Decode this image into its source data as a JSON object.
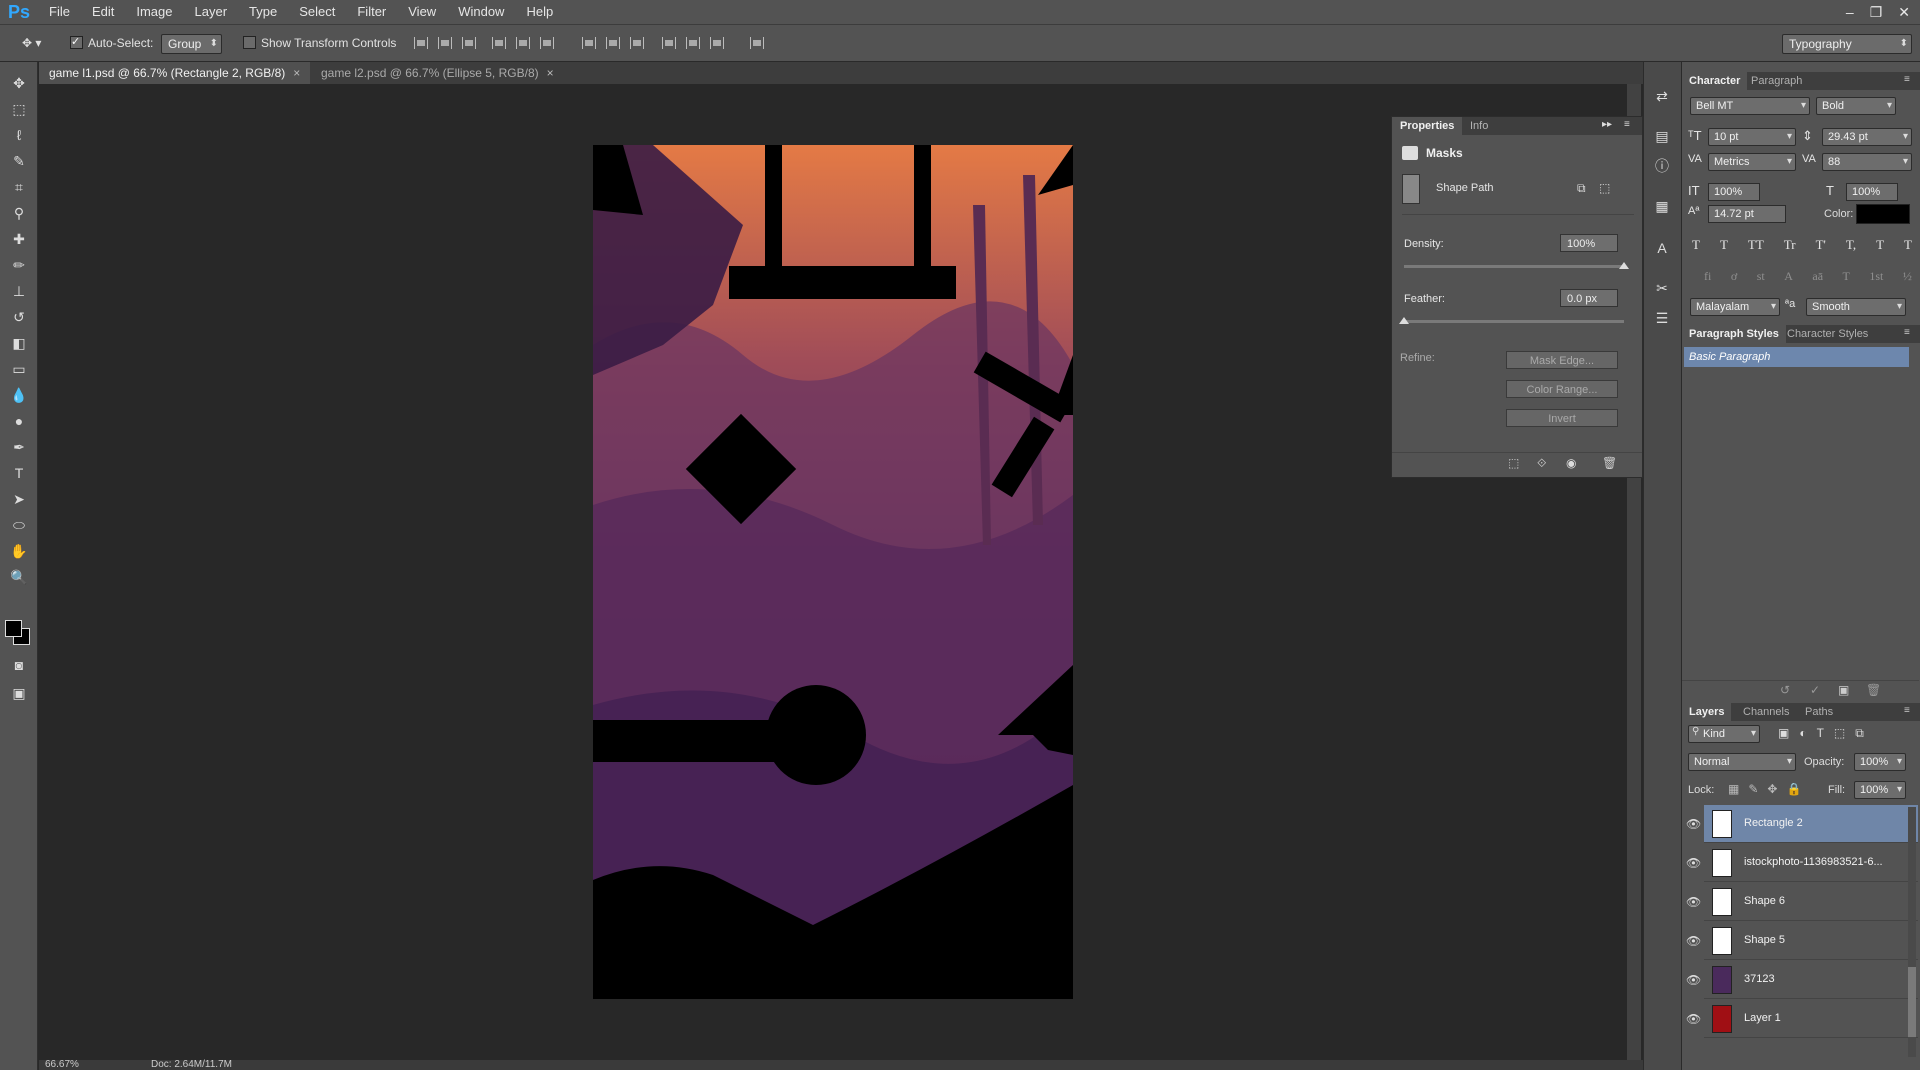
{
  "app": {
    "logo": "Ps"
  },
  "menu": [
    "File",
    "Edit",
    "Image",
    "Layer",
    "Type",
    "Select",
    "Filter",
    "View",
    "Window",
    "Help"
  ],
  "window_controls": [
    "–",
    "❐",
    "✕"
  ],
  "options": {
    "auto_select_label": "Auto-Select:",
    "auto_select_value": "Group",
    "transform_label": "Show Transform Controls",
    "workspace": "Typography"
  },
  "tabs": [
    {
      "label": "game l1.psd @ 66.7% (Rectangle 2, RGB/8)",
      "close": "×"
    },
    {
      "label": "game l2.psd @ 66.7% (Ellipse 5, RGB/8)",
      "close": "×"
    }
  ],
  "status": {
    "zoom": "66.67%",
    "doc": "Doc: 2.64M/11.7M"
  },
  "properties": {
    "tabs": [
      "Properties",
      "Info"
    ],
    "section": "Masks",
    "path_label": "Shape Path",
    "density_label": "Density:",
    "density_value": "100%",
    "density_level": 1.0,
    "feather_label": "Feather:",
    "feather_value": "0.0 px",
    "feather_level": 0.0,
    "refine_label": "Refine:",
    "buttons": [
      "Mask Edge...",
      "Color Range...",
      "Invert"
    ]
  },
  "character": {
    "tabs": [
      "Character",
      "Paragraph"
    ],
    "font": "Bell MT",
    "style": "Bold",
    "size": "10 pt",
    "leading": "29.43 pt",
    "kerning": "Metrics",
    "tracking": "88",
    "vscale": "100%",
    "hscale": "100%",
    "baseline": "14.72 pt",
    "color_label": "Color:",
    "color": "#000000",
    "language": "Malayalam",
    "antialias_prefix": "ªa",
    "antialias": "Smooth",
    "style_glyphs": [
      "T",
      "T",
      "TT",
      "Tr",
      "T'",
      "T,",
      "T",
      "T"
    ],
    "opentype_glyphs": [
      "fi",
      "ơ",
      "st",
      "A",
      "aā",
      "T",
      "1st",
      "½"
    ]
  },
  "paragraph_styles": {
    "tabs": [
      "Paragraph Styles",
      "Character Styles"
    ],
    "items": [
      "Basic Paragraph"
    ]
  },
  "layers_panel": {
    "tabs": [
      "Layers",
      "Channels",
      "Paths"
    ],
    "filter": "Kind",
    "blend_mode": "Normal",
    "opacity_label": "Opacity:",
    "opacity": "100%",
    "lock_label": "Lock:",
    "fill_label": "Fill:",
    "fill": "100%",
    "layers": [
      {
        "name": "Rectangle 2",
        "selected": true,
        "thumb": "#ffffff"
      },
      {
        "name": "istockphoto-1136983521-6...",
        "selected": false,
        "thumb": "#ffffff"
      },
      {
        "name": "Shape 6",
        "selected": false,
        "thumb": "#ffffff"
      },
      {
        "name": "Shape 5",
        "selected": false,
        "thumb": "#ffffff"
      },
      {
        "name": "37123",
        "selected": false,
        "thumb": "#4a2a5c"
      },
      {
        "name": "Layer 1",
        "selected": false,
        "thumb": "#a00f14"
      }
    ]
  }
}
